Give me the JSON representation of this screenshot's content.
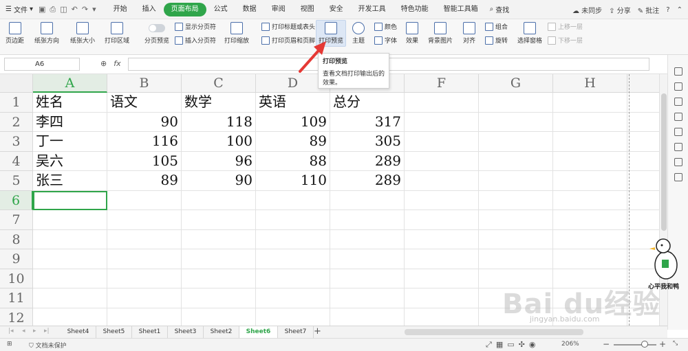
{
  "menubar": {
    "file_label": "文件",
    "tabs": [
      {
        "label": "开始"
      },
      {
        "label": "插入"
      },
      {
        "label": "页面布局",
        "active": true
      },
      {
        "label": "公式"
      },
      {
        "label": "数据"
      },
      {
        "label": "审阅"
      },
      {
        "label": "视图"
      },
      {
        "label": "安全"
      },
      {
        "label": "开发工具"
      },
      {
        "label": "特色功能"
      },
      {
        "label": "智能工具箱"
      }
    ],
    "search_label": "查找",
    "sync_label": "未同步",
    "share_label": "分享",
    "comment_label": "批注"
  },
  "ribbon": {
    "margins": "页边距",
    "orientation": "纸张方向",
    "size": "纸张大小",
    "print_area": "打印区域",
    "page_break_preview": "分页预览",
    "show_page_breaks": "显示分页符",
    "insert_page_break": "插入分页符",
    "print_scale": "打印缩放",
    "print_titles": "打印标题或表头",
    "print_header_footer": "打印页眉和页脚",
    "print_preview": "打印预览",
    "theme": "主题",
    "colors": "颜色",
    "fonts": "字体",
    "effects": "效果",
    "background": "背景图片",
    "align": "对齐",
    "group": "组合",
    "rotate": "旋转",
    "selection_pane": "选择窗格",
    "bring_forward": "上移一层",
    "send_backward": "下移一层"
  },
  "tooltip": {
    "title": "打印预览",
    "text": "查看文档打印输出后的效果。"
  },
  "formula_bar": {
    "name_box": "A6",
    "fx": "fx",
    "value": ""
  },
  "sheet": {
    "columns": [
      "A",
      "B",
      "C",
      "D",
      "E",
      "F",
      "G",
      "H"
    ],
    "rows": [
      "1",
      "2",
      "3",
      "4",
      "5",
      "6",
      "7",
      "8",
      "9",
      "10",
      "11",
      "12"
    ],
    "active_cell": "A6",
    "cells": [
      [
        "姓名",
        "语文",
        "数学",
        "英语",
        "总分"
      ],
      [
        "李四",
        "90",
        "118",
        "109",
        "317"
      ],
      [
        "丁一",
        "116",
        "100",
        "89",
        "305"
      ],
      [
        "吴六",
        "105",
        "96",
        "88",
        "289"
      ],
      [
        "张三",
        "89",
        "90",
        "110",
        "289"
      ]
    ]
  },
  "sheet_tabs": [
    {
      "label": "Sheet4"
    },
    {
      "label": "Sheet5"
    },
    {
      "label": "Sheet1"
    },
    {
      "label": "Sheet3"
    },
    {
      "label": "Sheet2"
    },
    {
      "label": "Sheet6",
      "active": true
    },
    {
      "label": "Sheet7"
    }
  ],
  "status": {
    "protection": "文档未保护",
    "zoom": "206%"
  },
  "watermark": {
    "text": "Bai du经验",
    "url": "jingyan.baidu.com",
    "badge": "心平我和鸭"
  },
  "colors": {
    "accent": "#2fa54a",
    "arrow": "#e53935"
  }
}
